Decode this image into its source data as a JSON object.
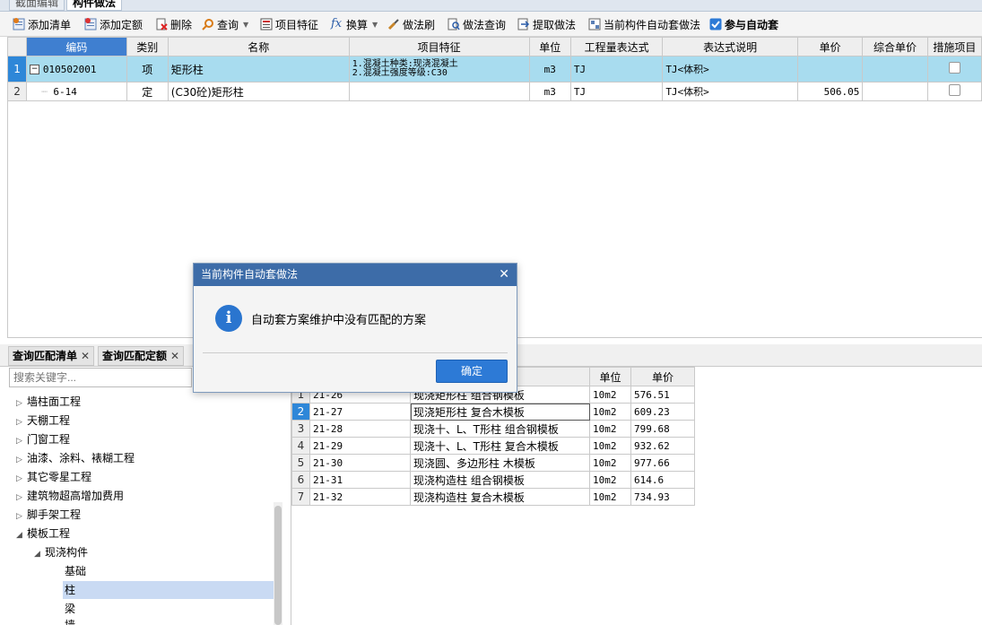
{
  "top_tabs": [
    "截面编辑",
    "构件做法"
  ],
  "toolbar": {
    "add_list": "添加清单",
    "add_quota": "添加定额",
    "delete": "删除",
    "query": "查询",
    "item_feature": "项目特征",
    "convert": "换算",
    "method_brush": "做法刷",
    "method_query": "做法查询",
    "extract_method": "提取做法",
    "auto_apply": "当前构件自动套做法",
    "participate_auto": "参与自动套"
  },
  "main_grid": {
    "headers": [
      "编码",
      "类别",
      "名称",
      "项目特征",
      "单位",
      "工程量表达式",
      "表达式说明",
      "单价",
      "综合单价",
      "措施项目"
    ],
    "rows": [
      {
        "num": "1",
        "code": "010502001",
        "type": "项",
        "name": "矩形柱",
        "feature_1": "1.混凝土种类:现浇混凝土",
        "feature_2": "2.混凝土强度等级:C30",
        "unit": "m3",
        "expr": "TJ",
        "desc": "TJ<体积>",
        "price": "",
        "total": ""
      },
      {
        "num": "2",
        "code": "6-14",
        "type": "定",
        "name": "(C30砼)矩形柱",
        "feature_1": "",
        "feature_2": "",
        "unit": "m3",
        "expr": "TJ",
        "desc": "TJ<体积>",
        "price": "506.05",
        "total": ""
      }
    ]
  },
  "lower": {
    "tabs": [
      "查询匹配清单",
      "查询匹配定额"
    ],
    "search_placeholder": "搜索关键字...",
    "tree": [
      "墙柱面工程",
      "天棚工程",
      "门窗工程",
      "油漆、涂料、裱糊工程",
      "其它零星工程",
      "建筑物超高增加费用",
      "脚手架工程",
      "模板工程",
      "现浇构件",
      "基础",
      "柱",
      "梁",
      "墙"
    ],
    "grid_headers": [
      "单位",
      "单价"
    ],
    "rows": [
      {
        "num": "1",
        "code": "21-26",
        "name": "现浇矩形柱 组合钢模板",
        "unit": "10m2",
        "price": "576.51"
      },
      {
        "num": "2",
        "code": "21-27",
        "name": "现浇矩形柱 复合木模板",
        "unit": "10m2",
        "price": "609.23"
      },
      {
        "num": "3",
        "code": "21-28",
        "name": "现浇十、L、T形柱 组合钢模板",
        "unit": "10m2",
        "price": "799.68"
      },
      {
        "num": "4",
        "code": "21-29",
        "name": "现浇十、L、T形柱 复合木模板",
        "unit": "10m2",
        "price": "932.62"
      },
      {
        "num": "5",
        "code": "21-30",
        "name": "现浇圆、多边形柱 木模板",
        "unit": "10m2",
        "price": "977.66"
      },
      {
        "num": "6",
        "code": "21-31",
        "name": "现浇构造柱 组合钢模板",
        "unit": "10m2",
        "price": "614.6"
      },
      {
        "num": "7",
        "code": "21-32",
        "name": "现浇构造柱 复合木模板",
        "unit": "10m2",
        "price": "734.93"
      }
    ]
  },
  "dialog": {
    "title": "当前构件自动套做法",
    "message": "自动套方案维护中没有匹配的方案",
    "ok": "确定"
  },
  "colors": {
    "selected_row": "#a8dcef",
    "dialog_title": "#3d6ca8",
    "ok_button": "#2d7ad6"
  }
}
